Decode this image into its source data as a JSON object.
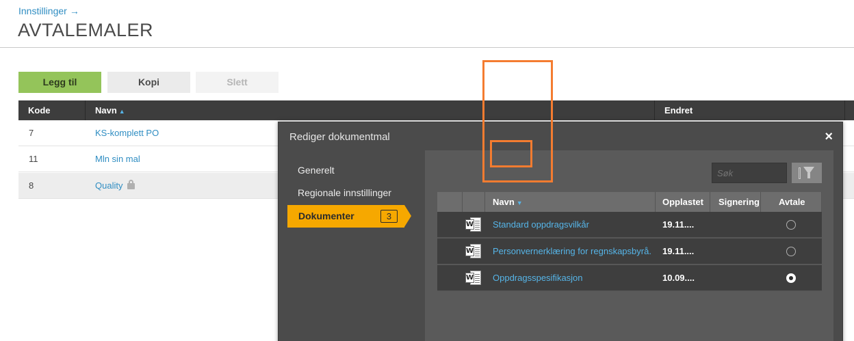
{
  "header": {
    "breadcrumb": "Innstillinger",
    "breadcrumb_arrow": "→",
    "title": "AVTALEMALER"
  },
  "toolbar": {
    "add_label": "Legg til",
    "copy_label": "Kopi",
    "delete_label": "Slett"
  },
  "main_table": {
    "columns": [
      "Kode",
      "Navn",
      "Endret"
    ],
    "sort_indicator": "▲",
    "rows": [
      {
        "kode": "7",
        "navn": "KS-komplett PO",
        "locked": false
      },
      {
        "kode": "11",
        "navn": "Mln sin mal",
        "locked": false
      },
      {
        "kode": "8",
        "navn": "Quality",
        "locked": true
      }
    ]
  },
  "modal": {
    "title": "Rediger dokumentmal",
    "close_symbol": "×",
    "nav": [
      {
        "label": "Generelt"
      },
      {
        "label": "Regionale innstillinger"
      },
      {
        "label": "Dokumenter",
        "badge": "3",
        "active": true
      }
    ],
    "search_placeholder": "Søk",
    "doc_table": {
      "columns": [
        "Navn",
        "Opplastet",
        "Signering",
        "Avtale"
      ],
      "sort_indicator": "▼",
      "rows": [
        {
          "icon": "word-document-icon",
          "navn": "Standard oppdragsvilkår",
          "opplastet": "19.11....",
          "avtale_selected": false
        },
        {
          "icon": "word-document-icon",
          "navn": "Personvernerklæring for regnskapsbyrå.",
          "opplastet": "19.11....",
          "avtale_selected": false
        },
        {
          "icon": "word-document-icon",
          "navn": "Oppdragsspesifikasjon",
          "opplastet": "10.09....",
          "avtale_selected": true
        }
      ]
    }
  },
  "colors": {
    "accent_blue": "#2f8dc2",
    "add_green": "#94c45a",
    "active_orange": "#f6a800",
    "highlight_orange": "#f47c30"
  }
}
